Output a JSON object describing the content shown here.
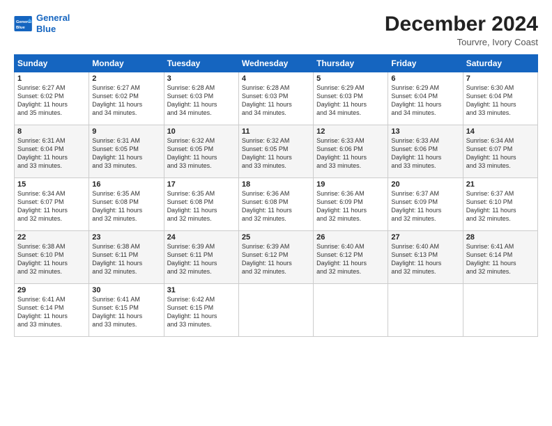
{
  "logo": {
    "line1": "General",
    "line2": "Blue"
  },
  "title": "December 2024",
  "subtitle": "Tourvre, Ivory Coast",
  "header_days": [
    "Sunday",
    "Monday",
    "Tuesday",
    "Wednesday",
    "Thursday",
    "Friday",
    "Saturday"
  ],
  "weeks": [
    [
      {
        "day": "1",
        "info": "Sunrise: 6:27 AM\nSunset: 6:02 PM\nDaylight: 11 hours\nand 35 minutes."
      },
      {
        "day": "2",
        "info": "Sunrise: 6:27 AM\nSunset: 6:02 PM\nDaylight: 11 hours\nand 34 minutes."
      },
      {
        "day": "3",
        "info": "Sunrise: 6:28 AM\nSunset: 6:03 PM\nDaylight: 11 hours\nand 34 minutes."
      },
      {
        "day": "4",
        "info": "Sunrise: 6:28 AM\nSunset: 6:03 PM\nDaylight: 11 hours\nand 34 minutes."
      },
      {
        "day": "5",
        "info": "Sunrise: 6:29 AM\nSunset: 6:03 PM\nDaylight: 11 hours\nand 34 minutes."
      },
      {
        "day": "6",
        "info": "Sunrise: 6:29 AM\nSunset: 6:04 PM\nDaylight: 11 hours\nand 34 minutes."
      },
      {
        "day": "7",
        "info": "Sunrise: 6:30 AM\nSunset: 6:04 PM\nDaylight: 11 hours\nand 33 minutes."
      }
    ],
    [
      {
        "day": "8",
        "info": "Sunrise: 6:31 AM\nSunset: 6:04 PM\nDaylight: 11 hours\nand 33 minutes."
      },
      {
        "day": "9",
        "info": "Sunrise: 6:31 AM\nSunset: 6:05 PM\nDaylight: 11 hours\nand 33 minutes."
      },
      {
        "day": "10",
        "info": "Sunrise: 6:32 AM\nSunset: 6:05 PM\nDaylight: 11 hours\nand 33 minutes."
      },
      {
        "day": "11",
        "info": "Sunrise: 6:32 AM\nSunset: 6:05 PM\nDaylight: 11 hours\nand 33 minutes."
      },
      {
        "day": "12",
        "info": "Sunrise: 6:33 AM\nSunset: 6:06 PM\nDaylight: 11 hours\nand 33 minutes."
      },
      {
        "day": "13",
        "info": "Sunrise: 6:33 AM\nSunset: 6:06 PM\nDaylight: 11 hours\nand 33 minutes."
      },
      {
        "day": "14",
        "info": "Sunrise: 6:34 AM\nSunset: 6:07 PM\nDaylight: 11 hours\nand 33 minutes."
      }
    ],
    [
      {
        "day": "15",
        "info": "Sunrise: 6:34 AM\nSunset: 6:07 PM\nDaylight: 11 hours\nand 32 minutes."
      },
      {
        "day": "16",
        "info": "Sunrise: 6:35 AM\nSunset: 6:08 PM\nDaylight: 11 hours\nand 32 minutes."
      },
      {
        "day": "17",
        "info": "Sunrise: 6:35 AM\nSunset: 6:08 PM\nDaylight: 11 hours\nand 32 minutes."
      },
      {
        "day": "18",
        "info": "Sunrise: 6:36 AM\nSunset: 6:08 PM\nDaylight: 11 hours\nand 32 minutes."
      },
      {
        "day": "19",
        "info": "Sunrise: 6:36 AM\nSunset: 6:09 PM\nDaylight: 11 hours\nand 32 minutes."
      },
      {
        "day": "20",
        "info": "Sunrise: 6:37 AM\nSunset: 6:09 PM\nDaylight: 11 hours\nand 32 minutes."
      },
      {
        "day": "21",
        "info": "Sunrise: 6:37 AM\nSunset: 6:10 PM\nDaylight: 11 hours\nand 32 minutes."
      }
    ],
    [
      {
        "day": "22",
        "info": "Sunrise: 6:38 AM\nSunset: 6:10 PM\nDaylight: 11 hours\nand 32 minutes."
      },
      {
        "day": "23",
        "info": "Sunrise: 6:38 AM\nSunset: 6:11 PM\nDaylight: 11 hours\nand 32 minutes."
      },
      {
        "day": "24",
        "info": "Sunrise: 6:39 AM\nSunset: 6:11 PM\nDaylight: 11 hours\nand 32 minutes."
      },
      {
        "day": "25",
        "info": "Sunrise: 6:39 AM\nSunset: 6:12 PM\nDaylight: 11 hours\nand 32 minutes."
      },
      {
        "day": "26",
        "info": "Sunrise: 6:40 AM\nSunset: 6:12 PM\nDaylight: 11 hours\nand 32 minutes."
      },
      {
        "day": "27",
        "info": "Sunrise: 6:40 AM\nSunset: 6:13 PM\nDaylight: 11 hours\nand 32 minutes."
      },
      {
        "day": "28",
        "info": "Sunrise: 6:41 AM\nSunset: 6:14 PM\nDaylight: 11 hours\nand 32 minutes."
      }
    ],
    [
      {
        "day": "29",
        "info": "Sunrise: 6:41 AM\nSunset: 6:14 PM\nDaylight: 11 hours\nand 33 minutes."
      },
      {
        "day": "30",
        "info": "Sunrise: 6:41 AM\nSunset: 6:15 PM\nDaylight: 11 hours\nand 33 minutes."
      },
      {
        "day": "31",
        "info": "Sunrise: 6:42 AM\nSunset: 6:15 PM\nDaylight: 11 hours\nand 33 minutes."
      },
      null,
      null,
      null,
      null
    ]
  ]
}
